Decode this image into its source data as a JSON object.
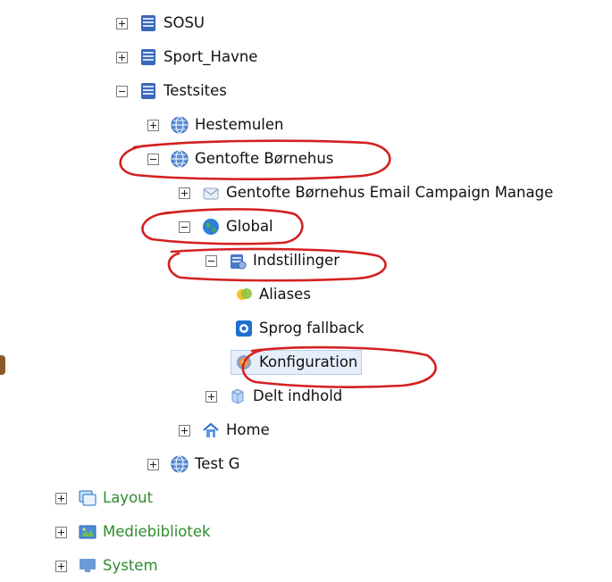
{
  "tree": [
    {
      "label": "SOSU",
      "toggle": "plus",
      "icon": "database-icon",
      "label_color": "default"
    },
    {
      "label": "Sport_Havne",
      "toggle": "plus",
      "icon": "database-icon",
      "label_color": "default"
    },
    {
      "label": "Testsites",
      "toggle": "minus",
      "icon": "database-icon",
      "label_color": "default"
    },
    {
      "label": "Hestemulen",
      "toggle": "plus",
      "icon": "globe-icon",
      "label_color": "default"
    },
    {
      "label": "Gentofte Børnehus",
      "toggle": "minus",
      "icon": "globe-icon",
      "label_color": "default"
    },
    {
      "label": "Gentofte Børnehus Email Campaign Manage",
      "toggle": "plus",
      "icon": "email-campaign-icon",
      "label_color": "default"
    },
    {
      "label": "Global",
      "toggle": "minus",
      "icon": "earth-icon",
      "label_color": "default"
    },
    {
      "label": "Indstillinger",
      "toggle": "minus",
      "icon": "settings-folder-icon",
      "label_color": "default"
    },
    {
      "label": "Aliases",
      "toggle": "none",
      "icon": "aliases-icon",
      "label_color": "default"
    },
    {
      "label": "Sprog fallback",
      "toggle": "none",
      "icon": "language-icon",
      "label_color": "default"
    },
    {
      "label": "Konfiguration",
      "toggle": "none",
      "icon": "gear-icon",
      "label_color": "default",
      "selected": true
    },
    {
      "label": "Delt indhold",
      "toggle": "plus",
      "icon": "shared-content-icon",
      "label_color": "default"
    },
    {
      "label": "Home",
      "toggle": "plus",
      "icon": "home-icon",
      "label_color": "default"
    },
    {
      "label": "Test G",
      "toggle": "plus",
      "icon": "globe-icon",
      "label_color": "default"
    },
    {
      "label": "Layout",
      "toggle": "plus",
      "icon": "layout-icon",
      "label_color": "green"
    },
    {
      "label": "Mediebibliotek",
      "toggle": "plus",
      "icon": "media-library-icon",
      "label_color": "green"
    },
    {
      "label": "System",
      "toggle": "plus",
      "icon": "system-icon",
      "label_color": "green"
    }
  ],
  "colors": {
    "annotation": "#d42020",
    "selected_background": "#e6eefc",
    "green_label": "#2e8b2e"
  }
}
